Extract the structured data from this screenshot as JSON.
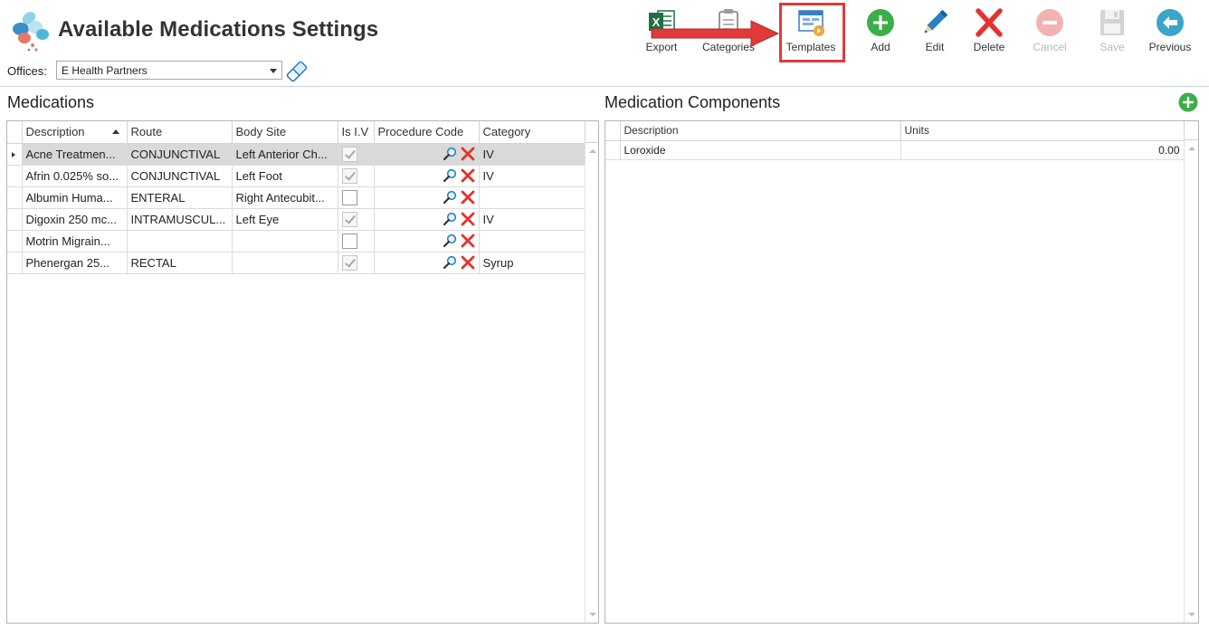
{
  "app": {
    "title": "Available Medications Settings"
  },
  "office": {
    "label": "Offices:",
    "selected": "E Health Partners"
  },
  "toolbar": {
    "export": "Export",
    "categories": "Categories",
    "templates": "Templates",
    "add": "Add",
    "edit": "Edit",
    "delete": "Delete",
    "cancel": "Cancel",
    "save": "Save",
    "previous": "Previous"
  },
  "medications": {
    "title": "Medications",
    "columns": [
      "Description",
      "Route",
      "Body Site",
      "Is I.V",
      "Procedure Code",
      "Category"
    ],
    "rows": [
      {
        "description": "Acne Treatmen...",
        "route": "CONJUNCTIVAL",
        "body_site": "Left Anterior Ch...",
        "is_iv": true,
        "category": "IV"
      },
      {
        "description": "Afrin 0.025% so...",
        "route": "CONJUNCTIVAL",
        "body_site": "Left Foot",
        "is_iv": true,
        "category": "IV"
      },
      {
        "description": "Albumin Huma...",
        "route": "ENTERAL",
        "body_site": "Right Antecubit...",
        "is_iv": false,
        "category": ""
      },
      {
        "description": "Digoxin 250 mc...",
        "route": "INTRAMUSCUL...",
        "body_site": "Left Eye",
        "is_iv": true,
        "category": "IV"
      },
      {
        "description": "Motrin Migrain...",
        "route": "",
        "body_site": "",
        "is_iv": false,
        "category": ""
      },
      {
        "description": "Phenergan 25...",
        "route": "RECTAL",
        "body_site": "",
        "is_iv": true,
        "category": "Syrup"
      }
    ]
  },
  "components": {
    "title": "Medication Components",
    "columns": [
      "Description",
      "Units"
    ],
    "rows": [
      {
        "description": "Loroxide",
        "units": "0.00"
      }
    ]
  },
  "colors": {
    "highlight": "#e03a3a",
    "add_green": "#3cae49",
    "delete_red": "#e5322d",
    "previous_teal": "#3aa6c8",
    "edit_blue": "#2a7fc1",
    "excel_green": "#1e7145"
  }
}
